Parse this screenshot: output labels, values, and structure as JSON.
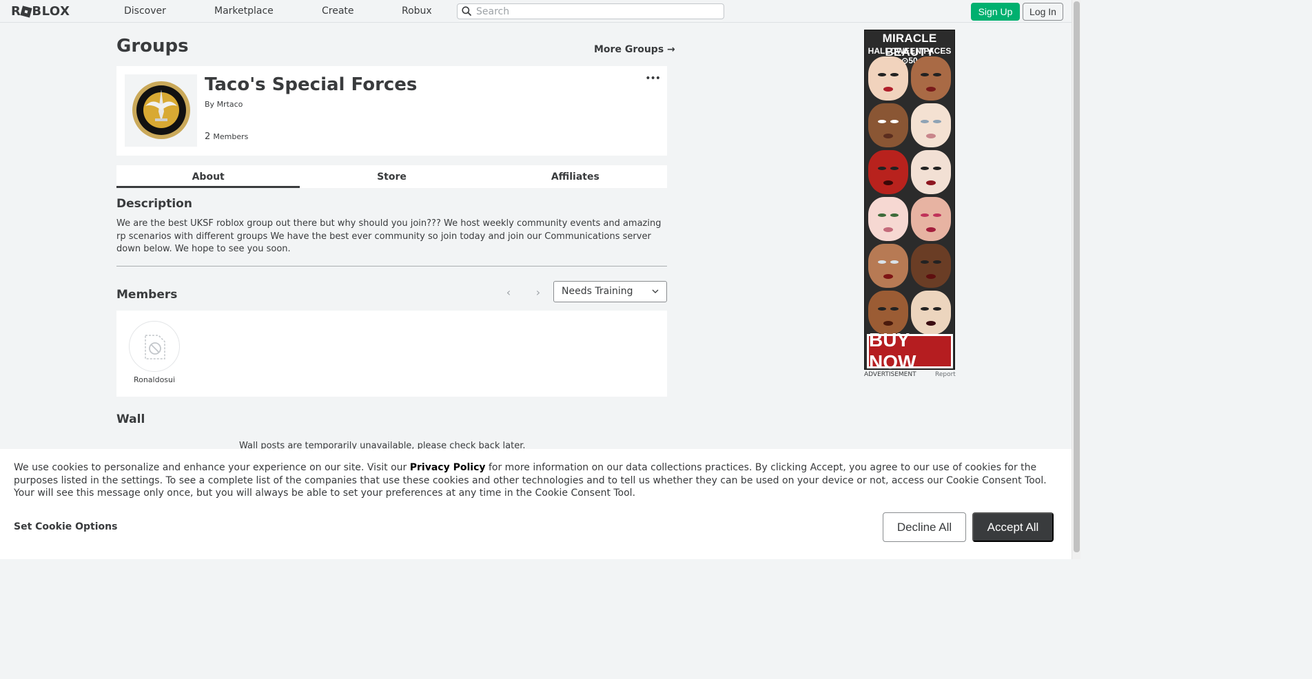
{
  "header": {
    "logo_text": "ROBLOX",
    "nav": [
      "Discover",
      "Marketplace",
      "Create",
      "Robux"
    ],
    "search_placeholder": "Search",
    "sign_up": "Sign Up",
    "log_in": "Log In"
  },
  "page": {
    "title": "Groups",
    "more_groups": "More Groups →"
  },
  "group": {
    "name": "Taco's Special Forces",
    "by_label": "By",
    "owner": "Mrtaco",
    "member_count": "2",
    "members_label": "Members",
    "more_menu": "•••"
  },
  "tabs": [
    "About",
    "Store",
    "Affiliates"
  ],
  "description": {
    "title": "Description",
    "text": "We are the best UKSF roblox group out there but why should you join??? We host weekly community events and amazing rp scenarios with different groups We have the best ever community so join today and join our Communications server down below. We hope to see you soon."
  },
  "members": {
    "title": "Members",
    "role_selected": "Needs Training",
    "list": [
      {
        "name": "Ronaldosui"
      }
    ]
  },
  "wall": {
    "title": "Wall",
    "note": "Wall posts are temporarily unavailable, please check back later."
  },
  "ad": {
    "headline": "MIRACLE BEAUTY",
    "subline": "HALLOWEEN FACES ⊙50",
    "cta": "BUY NOW",
    "label": "ADVERTISEMENT",
    "report": "Report"
  },
  "cookie": {
    "text_before": "We use cookies to personalize and enhance your experience on our site. Visit our ",
    "link": "Privacy Policy",
    "text_after": " for more information on our data collections practices. By clicking Accept, you agree to our use of cookies for the purposes listed in the settings. To see a complete list of the companies that use these cookies and other technologies and to tell us whether they can be used on your device or not, access our Cookie Consent Tool. Your will see this message only once, but you will always be able to set your preferences at any time in the Cookie Consent Tool.",
    "options": "Set Cookie Options",
    "decline": "Decline All",
    "accept": "Accept All"
  }
}
